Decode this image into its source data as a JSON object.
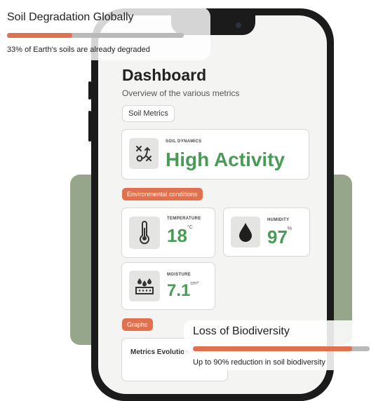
{
  "app": {
    "title": "Dashboard",
    "subtitle": "Overview of the various metrics",
    "metrics_pill": "Soil Metrics"
  },
  "soil_dynamics": {
    "label": "SOIL DYNAMICS",
    "value": "High Activity",
    "icon": "shuffle-icon"
  },
  "env_tag": "Environmental conditions",
  "temperature": {
    "label": "TEMPERATURE",
    "value": "18",
    "unit": "°C",
    "icon": "thermometer-icon"
  },
  "humidity": {
    "label": "HUMIDITY",
    "value": "97",
    "unit": "%",
    "icon": "water-drop-icon"
  },
  "moisture": {
    "label": "MOISTURE",
    "value": "7.1",
    "unit": "cm³",
    "icon": "soil-moisture-icon"
  },
  "graphs_tag": "Graphs",
  "graph_card_title": "Metrics Evolution",
  "stats": {
    "degradation": {
      "title": "Soil Degradation Globally",
      "caption": "33% of Earth's soils are already degraded",
      "progress": 0.37
    },
    "biodiversity": {
      "title": "Loss of Biodiversity",
      "caption": "Up to 90% reduction in soil biodiversity",
      "progress": 0.9
    }
  },
  "colors": {
    "accent": "#e0704e",
    "value_green": "#4a9b57",
    "card_green": "#95a68b"
  }
}
